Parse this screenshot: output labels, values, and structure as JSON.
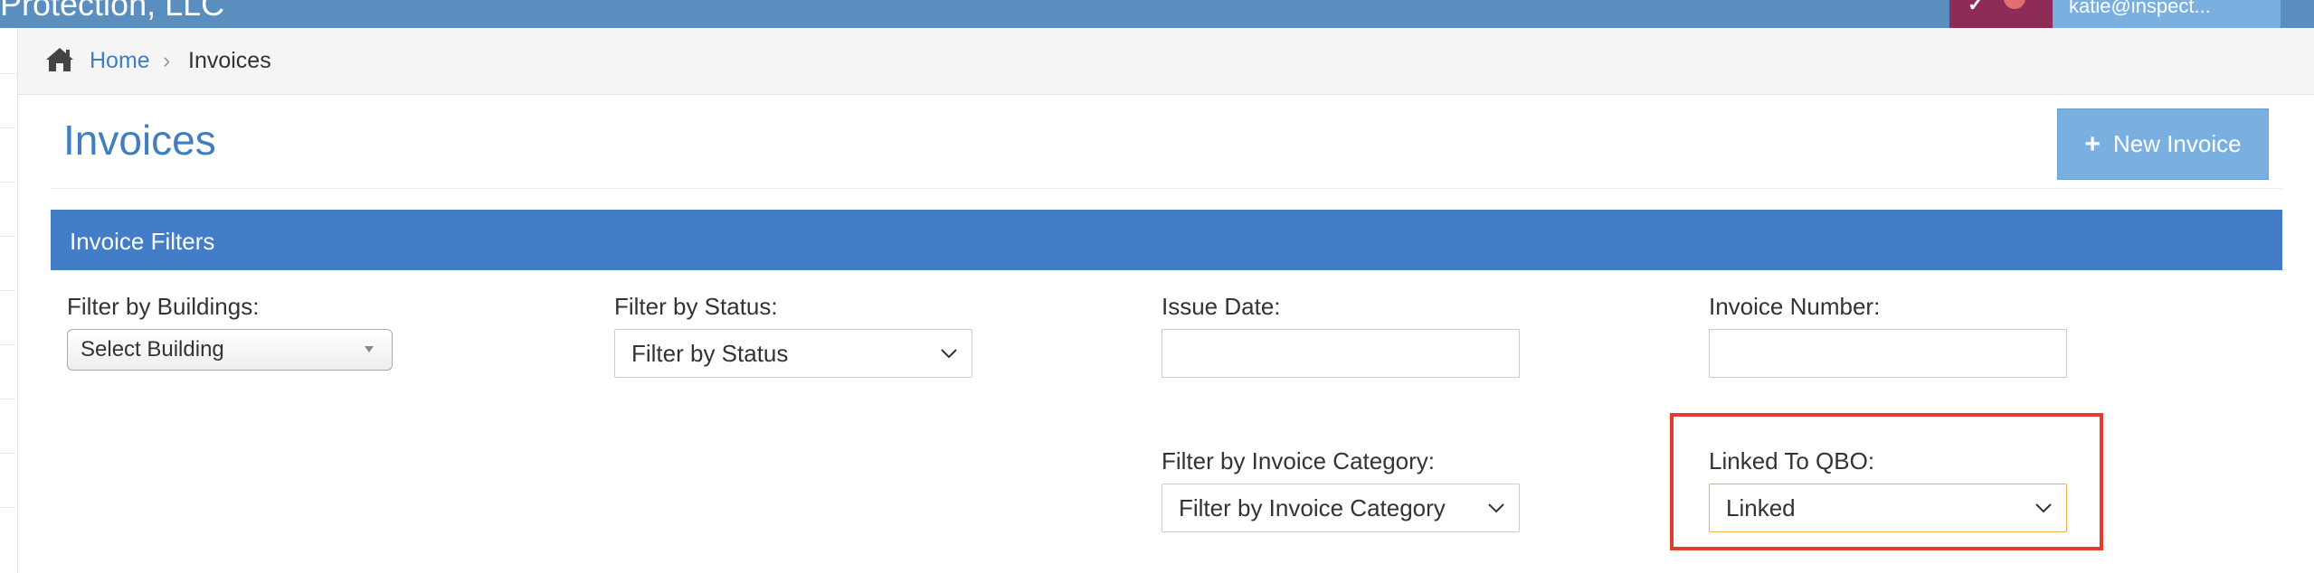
{
  "navbar": {
    "brand": "Protection, LLC",
    "user_label": "katie@inspect..."
  },
  "breadcrumb": {
    "home": "Home",
    "separator": "›",
    "current": "Invoices"
  },
  "page": {
    "title": "Invoices",
    "new_button_icon": "+",
    "new_button_label": "New Invoice"
  },
  "filters": {
    "heading": "Invoice Filters",
    "buildings": {
      "label": "Filter by Buildings:",
      "value": "Select Building"
    },
    "status": {
      "label": "Filter by Status:",
      "value": "Filter by Status"
    },
    "issue_date": {
      "label": "Issue Date:",
      "value": ""
    },
    "invoice_number": {
      "label": "Invoice Number:",
      "value": ""
    },
    "category": {
      "label": "Filter by Invoice Category:",
      "value": "Filter by Invoice Category"
    },
    "qbo": {
      "label": "Linked To QBO:",
      "value": "Linked"
    }
  },
  "colors": {
    "navbar": "#5a8ebf",
    "accent_link": "#3f7fbf",
    "panel_heading": "#437dc8",
    "button_primary": "#7ab0e0",
    "highlight": "#e53c2e"
  },
  "icons": {
    "home": "home-icon",
    "chevron": "chevron-down-icon",
    "plus": "plus-icon"
  }
}
